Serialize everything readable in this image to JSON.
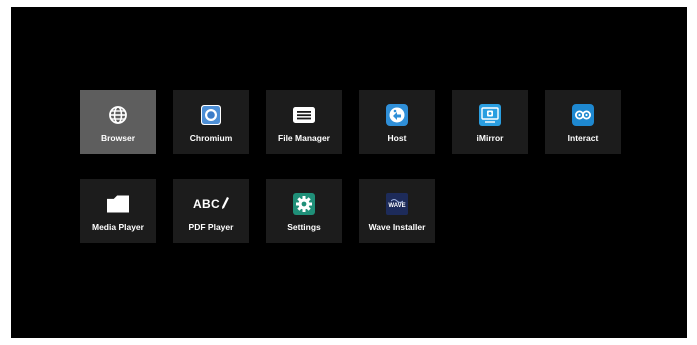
{
  "launcher": {
    "apps": [
      {
        "label": "Browser",
        "icon": "globe-icon",
        "selected": true
      },
      {
        "label": "Chromium",
        "icon": "chromium-icon"
      },
      {
        "label": "File Manager",
        "icon": "file-manager-icon"
      },
      {
        "label": "Host",
        "icon": "host-icon"
      },
      {
        "label": "iMirror",
        "icon": "imirror-icon"
      },
      {
        "label": "Interact",
        "icon": "interact-icon"
      },
      {
        "label": "Media Player",
        "icon": "folder-icon"
      },
      {
        "label": "PDF Player",
        "icon": "pdf-abc-icon",
        "icon_text": "ABC"
      },
      {
        "label": "Settings",
        "icon": "gear-icon"
      },
      {
        "label": "Wave Installer",
        "icon": "wave-icon",
        "icon_text": "WAVE"
      }
    ]
  },
  "colors": {
    "screen_bg": "#000000",
    "tile_bg": "#1c1c1c",
    "tile_selected_bg": "#5e5e5e",
    "host_blue": "#2f8fd8",
    "imirror_blue": "#2a9ee0",
    "interact_blue": "#1e88d0",
    "settings_teal": "#1f8f78",
    "wave_navy": "#1d2b5a"
  }
}
